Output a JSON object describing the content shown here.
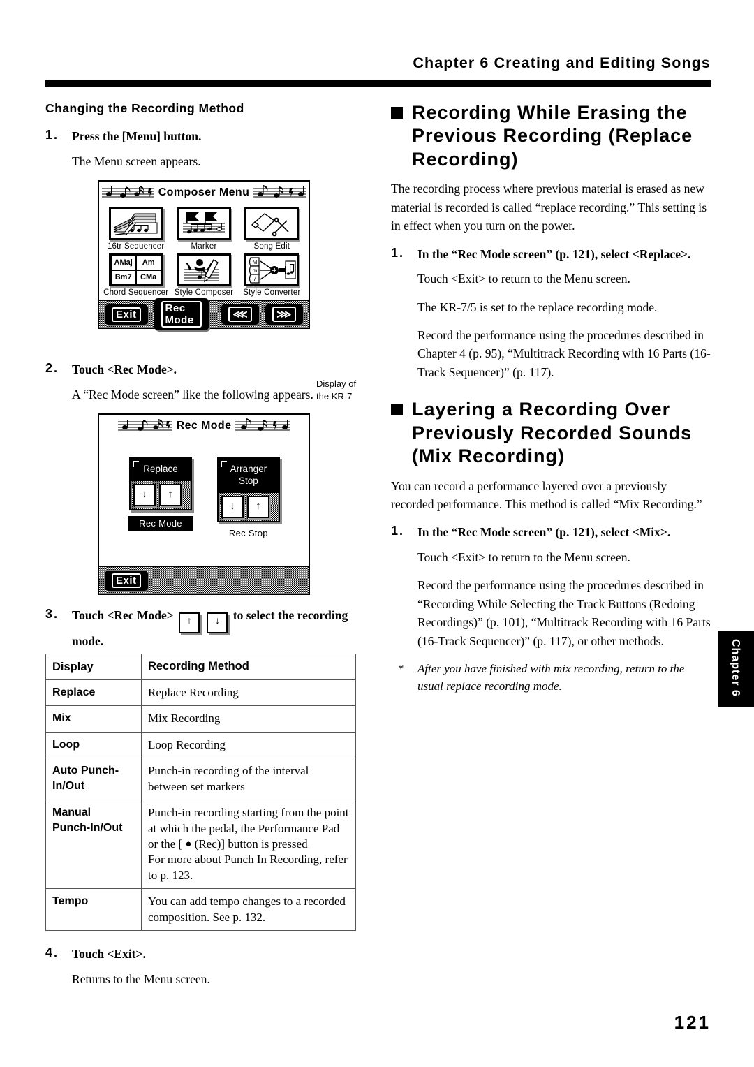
{
  "header": {
    "title": "Chapter 6 Creating and Editing Songs"
  },
  "left": {
    "section_heading": "Changing the Recording Method",
    "steps": [
      {
        "num": "1.",
        "title": "Press the [Menu] button.",
        "body": "The Menu screen appears."
      },
      {
        "num": "2.",
        "title": "Touch <Rec Mode>.",
        "body": "A “Rec Mode screen” like the following appears."
      },
      {
        "num": "3.",
        "title_a": "Touch <Rec Mode>",
        "title_b": "to select the recording mode.",
        "key_up": "↑",
        "key_down": "↓"
      },
      {
        "num": "4.",
        "title": "Touch <Exit>.",
        "body": "Returns to the Menu screen."
      }
    ],
    "caption": "Display of\nthe KR-7"
  },
  "composer_menu": {
    "title": "Composer Menu",
    "icons": [
      {
        "label": "16tr Sequencer",
        "icon": "keyboard-stack-icon"
      },
      {
        "label": "Marker",
        "icon": "marker-flags-icon"
      },
      {
        "label": "Song Edit",
        "icon": "glue-scissors-icon"
      },
      {
        "label": "Chord Sequencer",
        "icon": "chord-grid-icon",
        "chords": [
          "AMaj",
          "Am",
          "Bm7",
          "CMa"
        ]
      },
      {
        "label": "Style Composer",
        "icon": "style-composer-icon"
      },
      {
        "label": "Style Converter",
        "icon": "style-converter-icon"
      }
    ],
    "buttons": {
      "exit": "Exit",
      "rec_mode": "Rec Mode",
      "prev": "⋘",
      "next": "⋙"
    }
  },
  "rec_mode_screen": {
    "title": "Rec Mode",
    "panels": [
      {
        "display": "Replace",
        "label": "Rec Mode",
        "label_inverted": true,
        "down": "↓",
        "up": "↑"
      },
      {
        "display": "Arranger\nStop",
        "label": "Rec Stop",
        "label_inverted": false,
        "down": "↓",
        "up": "↑"
      }
    ],
    "exit": "Exit"
  },
  "table": {
    "headers": [
      "Display",
      "Recording Method"
    ],
    "rows": [
      {
        "display": "Replace",
        "method": "Replace Recording"
      },
      {
        "display": "Mix",
        "method": "Mix Recording"
      },
      {
        "display": "Loop",
        "method": "Loop Recording"
      },
      {
        "display": "Auto Punch-\nIn/Out",
        "method": "Punch-in recording of the interval between set markers"
      },
      {
        "display": "Manual\nPunch-In/Out",
        "method_a": "Punch-in recording starting from the point at which the pedal, the Performance Pad or the [ ",
        "method_dot": "●",
        "method_b": " (Rec)] button is pressed",
        "method_c": "For more about Punch In Recording, refer to p. 123."
      },
      {
        "display": "Tempo",
        "method": "You can add tempo changes to a recorded composition. See p. 132."
      }
    ]
  },
  "right": {
    "heading1": "Recording While Erasing the Previous Recording (Replace Recording)",
    "para1": "The recording process where previous material is erased as new material is recorded is called “replace recording.” This setting is in effect when you turn on the power.",
    "step1": {
      "num": "1.",
      "title": "In the “Rec Mode screen” (p. 121), select <Replace>.",
      "body1": "Touch <Exit> to return to the Menu screen.",
      "body2": "The KR-7/5 is set to the replace recording mode.",
      "body3": "Record the performance using the procedures described in Chapter 4 (p. 95), “Multitrack Recording with 16 Parts (16-Track Sequencer)” (p. 117)."
    },
    "heading2": "Layering a Recording Over Previously Recorded Sounds (Mix Recording)",
    "para2": "You can record a performance layered over a previously recorded performance. This method is called “Mix Recording.”",
    "step2": {
      "num": "1.",
      "title": "In the “Rec Mode screen” (p. 121), select <Mix>.",
      "body1": "Touch <Exit> to return to the Menu screen.",
      "body2": "Record the performance using the procedures described in “Recording While Selecting the Track Buttons (Redoing Recordings)” (p. 101), “Multitrack Recording with 16 Parts (16-Track Sequencer)” (p. 117), or other methods."
    },
    "footnote_star": "*",
    "footnote": "After you have finished with mix recording, return to the usual replace recording mode."
  },
  "chapter_tab": "Chapter 6",
  "page_number": "121"
}
